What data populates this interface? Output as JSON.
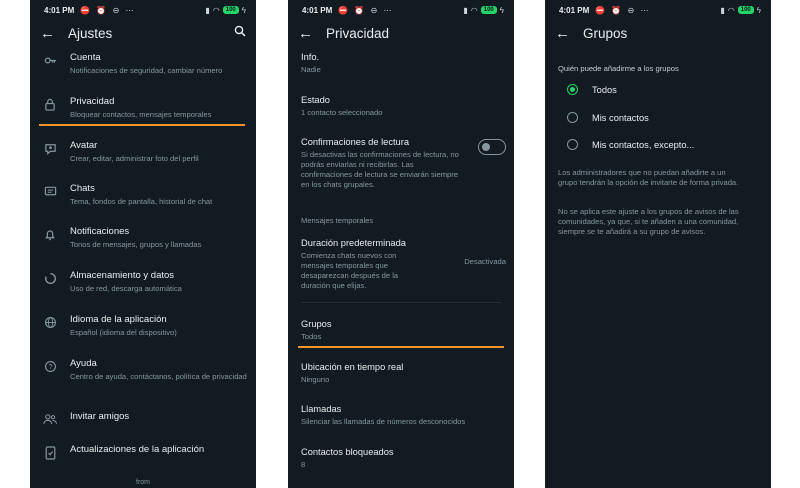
{
  "status": {
    "time": "4:01 PM",
    "icons": "⛔ ⏰ ⊖ ⋯",
    "battery": "100"
  },
  "ajustes": {
    "title": "Ajustes",
    "items": [
      {
        "title": "Cuenta",
        "subtitle": "Notificaciones de seguridad, cambiar número",
        "icon": "key-icon"
      },
      {
        "title": "Privacidad",
        "subtitle": "Bloquear contactos, mensajes temporales",
        "icon": "lock-icon"
      },
      {
        "title": "Avatar",
        "subtitle": "Crear, editar, administrar foto del perfil",
        "icon": "avatar-icon"
      },
      {
        "title": "Chats",
        "subtitle": "Tema, fondos de pantalla, historial de chat",
        "icon": "chat-icon"
      },
      {
        "title": "Notificaciones",
        "subtitle": "Tonos de mensajes, grupos y llamadas",
        "icon": "bell-icon"
      },
      {
        "title": "Almacenamiento y datos",
        "subtitle": "Uso de red, descarga automática",
        "icon": "storage-icon"
      },
      {
        "title": "Idioma de la aplicación",
        "subtitle": "Español (idioma del dispositivo)",
        "icon": "globe-icon"
      },
      {
        "title": "Ayuda",
        "subtitle": "Centro de ayuda, contáctanos, política de privacidad",
        "icon": "help-icon"
      },
      {
        "title": "Invitar amigos",
        "subtitle": "",
        "icon": "people-icon"
      },
      {
        "title": "Actualizaciones de la aplicación",
        "subtitle": "",
        "icon": "phone-update-icon"
      }
    ],
    "footer": "from"
  },
  "privacidad": {
    "title": "Privacidad",
    "info": {
      "title": "Info.",
      "subtitle": "Nadie"
    },
    "estado": {
      "title": "Estado",
      "subtitle": "1 contacto seleccionado"
    },
    "confirmaciones": {
      "title": "Confirmaciones de lectura",
      "subtitle": "Si desactivas las confirmaciones de lectura, no podrás enviarlas ni recibirlas. Las confirmaciones de lectura se enviarán siempre en los chats grupales."
    },
    "section_mensajes": "Mensajes temporales",
    "duracion": {
      "title": "Duración predeterminada",
      "subtitle": "Comienza chats nuevos con mensajes temporales que desaparezcan después de la duración que elijas.",
      "value": "Desactivada"
    },
    "grupos": {
      "title": "Grupos",
      "subtitle": "Todos"
    },
    "ubicacion": {
      "title": "Ubicación en tiempo real",
      "subtitle": "Ninguno"
    },
    "llamadas": {
      "title": "Llamadas",
      "subtitle": "Silenciar las llamadas de números desconocidos"
    },
    "bloqueados": {
      "title": "Contactos bloqueados",
      "subtitle": "8"
    }
  },
  "grupos": {
    "title": "Grupos",
    "heading": "Quién puede añadirme a los grupos",
    "options": [
      "Todos",
      "Mis contactos",
      "Mis contactos, excepto..."
    ],
    "selected_index": 0,
    "note1": "Los administradores que no puedan añadirte a un grupo tendrán la opción de invitarte de forma privada.",
    "note2": "No se aplica este ajuste a los grupos de avisos de las comunidades, ya que, si te añaden a una comunidad, siempre se te añadirá a su grupo de avisos."
  },
  "colors": {
    "background": "#121b22",
    "accent": "#25d366",
    "highlight": "#f0932b",
    "text": "#e9edef",
    "secondary": "#8696a0"
  }
}
